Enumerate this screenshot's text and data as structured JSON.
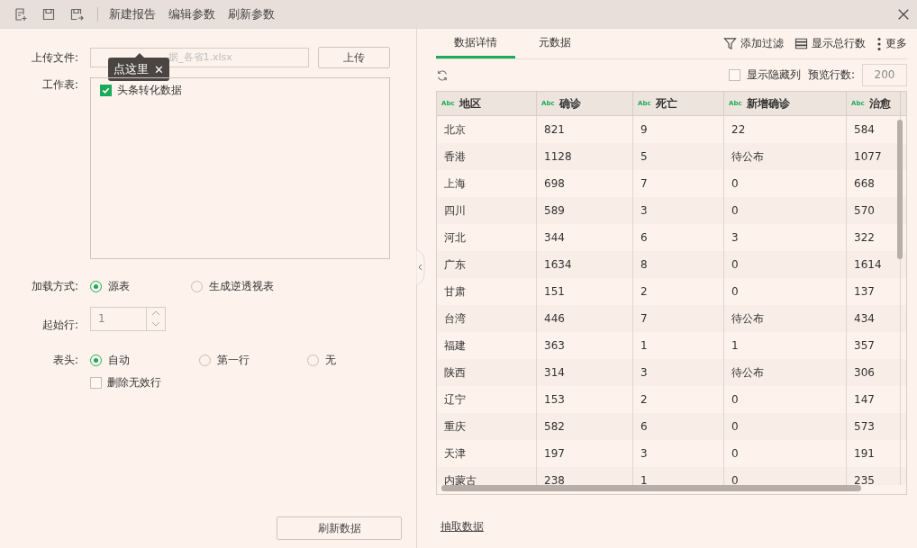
{
  "toolbar": {
    "buttons": [
      "新建报告",
      "编辑参数",
      "刷新参数"
    ]
  },
  "tooltip": {
    "text": "点这里",
    "close": "✕"
  },
  "form": {
    "upload": {
      "label": "上传文件:",
      "value": "据_各省1.xlsx",
      "button": "上传"
    },
    "sheet": {
      "label": "工作表:",
      "items": [
        {
          "label": "头条转化数据",
          "checked": true
        }
      ]
    },
    "load_mode": {
      "label": "加载方式:",
      "options": [
        {
          "label": "源表",
          "selected": true
        },
        {
          "label": "生成逆透视表",
          "selected": false
        }
      ]
    },
    "start_row": {
      "label": "起始行:",
      "value": "1"
    },
    "header": {
      "label": "表头:",
      "options": [
        {
          "label": "自动",
          "selected": true
        },
        {
          "label": "第一行",
          "selected": false
        },
        {
          "label": "无",
          "selected": false
        }
      ]
    },
    "remove_invalid": {
      "label": "删除无效行",
      "checked": false
    },
    "refresh_button": "刷新数据"
  },
  "tabs": [
    {
      "label": "数据详情",
      "selected": true
    },
    {
      "label": "元数据",
      "selected": false
    }
  ],
  "actions": [
    "添加过滤",
    "显示总行数",
    "更多"
  ],
  "options": {
    "show_hidden": {
      "label": "显示隐藏列",
      "checked": false
    },
    "preview_label": "预览行数:",
    "preview_value": "200"
  },
  "table": {
    "columns": [
      {
        "type": "Abc",
        "name": "地区"
      },
      {
        "type": "Abc",
        "name": "确诊"
      },
      {
        "type": "Abc",
        "name": "死亡"
      },
      {
        "type": "Abc",
        "name": "新增确诊"
      },
      {
        "type": "Abc",
        "name": "治愈"
      }
    ],
    "rows": [
      [
        "北京",
        "821",
        "9",
        "22",
        "584"
      ],
      [
        "香港",
        "1128",
        "5",
        "待公布",
        "1077"
      ],
      [
        "上海",
        "698",
        "7",
        "0",
        "668"
      ],
      [
        "四川",
        "589",
        "3",
        "0",
        "570"
      ],
      [
        "河北",
        "344",
        "6",
        "3",
        "322"
      ],
      [
        "广东",
        "1634",
        "8",
        "0",
        "1614"
      ],
      [
        "甘肃",
        "151",
        "2",
        "0",
        "137"
      ],
      [
        "台湾",
        "446",
        "7",
        "待公布",
        "434"
      ],
      [
        "福建",
        "363",
        "1",
        "1",
        "357"
      ],
      [
        "陕西",
        "314",
        "3",
        "待公布",
        "306"
      ],
      [
        "辽宁",
        "153",
        "2",
        "0",
        "147"
      ],
      [
        "重庆",
        "582",
        "6",
        "0",
        "573"
      ],
      [
        "天津",
        "197",
        "3",
        "0",
        "191"
      ],
      [
        "内蒙古",
        "238",
        "1",
        "0",
        "235"
      ]
    ]
  },
  "extract_link": "抽取数据"
}
